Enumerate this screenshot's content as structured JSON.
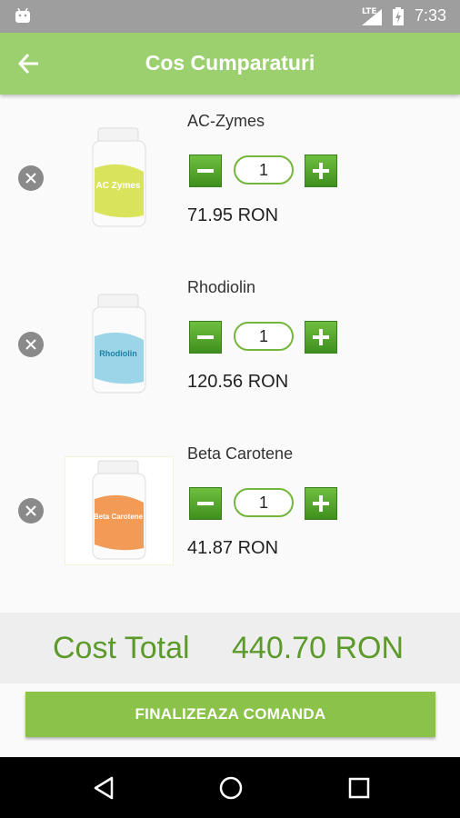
{
  "status_bar": {
    "network": "LTE",
    "time": "7:33"
  },
  "app_bar": {
    "title": "Cos Cumparaturi",
    "back_icon": "arrow-left-icon"
  },
  "cart": {
    "items": [
      {
        "name": "AC-Zymes",
        "quantity": "1",
        "price": "71.95 RON",
        "bottle_label": "AC Zymes",
        "label_color": "#d6e04a"
      },
      {
        "name": "Rhodiolin",
        "quantity": "1",
        "price": "120.56 RON",
        "bottle_label": "Rhodiolin",
        "label_color": "#4fb6d8"
      },
      {
        "name": "Beta Carotene",
        "quantity": "1",
        "price": "41.87 RON",
        "bottle_label": "Beta Carotene",
        "label_color": "#f08a3a"
      }
    ]
  },
  "total": {
    "label": "Cost Total",
    "value": "440.70 RON"
  },
  "actions": {
    "finish_label": "FINALIZEAZA COMANDA"
  },
  "colors": {
    "primary": "#9ccf6d",
    "accent": "#8bc34a",
    "total_text": "#5c9a2b",
    "qty_button": "#4fa32a"
  }
}
